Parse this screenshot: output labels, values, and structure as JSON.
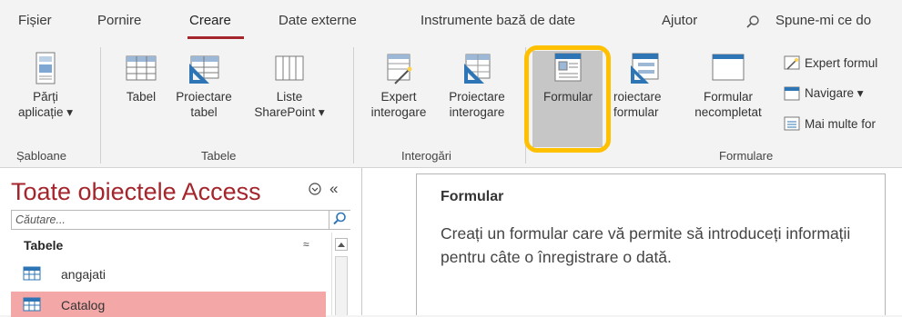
{
  "tabs": [
    {
      "label": "Fișier"
    },
    {
      "label": "Pornire"
    },
    {
      "label": "Creare"
    },
    {
      "label": "Date externe"
    },
    {
      "label": "Instrumente bază de date"
    },
    {
      "label": "Ajutor"
    }
  ],
  "tell_me": {
    "placeholder": "Spune-mi ce do"
  },
  "ribbon": {
    "templates": {
      "parts_line1": "Părți",
      "parts_line2": "aplicație ▾",
      "group": "Șabloane"
    },
    "tables": {
      "table": "Tabel",
      "table_design_line1": "Proiectare",
      "table_design_line2": "tabel",
      "sharepoint_line1": "Liste",
      "sharepoint_line2": "SharePoint ▾",
      "group": "Tabele"
    },
    "queries": {
      "wizard_line1": "Expert",
      "wizard_line2": "interogare",
      "design_line1": "Proiectare",
      "design_line2": "interogare",
      "group": "Interogări"
    },
    "forms": {
      "form": "Formular",
      "form_design_line1": "roiectare",
      "form_design_line2": "formular",
      "blank_line1": "Formular",
      "blank_line2": "necompletat",
      "wizard": "Expert formul",
      "navigation": "Navigare ▾",
      "more": "Mai multe for",
      "group": "Formulare"
    }
  },
  "nav": {
    "title": "Toate obiectele Access",
    "collapse": "«",
    "search_placeholder": "Căutare...",
    "section": "Tabele",
    "section_collapse": "≈",
    "items": [
      {
        "label": "angajati"
      },
      {
        "label": "Catalog"
      }
    ]
  },
  "tooltip": {
    "title": "Formular",
    "body": "Creați un formular care vă permite să introduceți informații pentru câte o înregistrare o dată."
  },
  "colors": {
    "accent": "#a4262c",
    "highlight": "#ffc000",
    "selected_row": "#f4a7a7"
  }
}
